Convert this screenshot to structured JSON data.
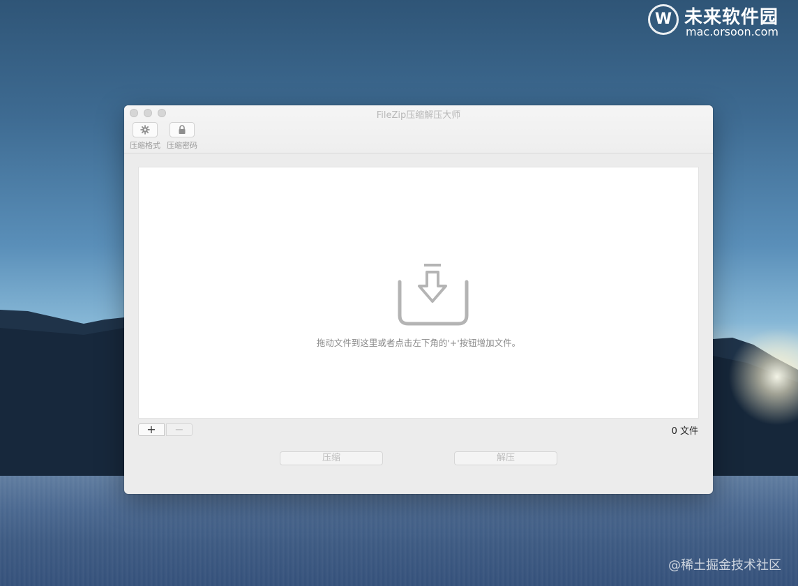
{
  "watermark": {
    "logo_mark": "W",
    "site_name": "未来软件园",
    "site_url": "mac.orsoon.com",
    "corner_text": "@稀土掘金技术社区"
  },
  "window": {
    "title": "FileZip压缩解压大师",
    "toolbar": [
      {
        "label": "压缩格式",
        "icon": "gear-icon"
      },
      {
        "label": "压缩密码",
        "icon": "lock-icon"
      }
    ]
  },
  "drop_area": {
    "icon": "download-tray-icon",
    "hint": "拖动文件到这里或者点击左下角的'+'按钮增加文件。"
  },
  "file_controls": {
    "add_label": "+",
    "remove_label": "−",
    "file_count": "0 文件"
  },
  "actions": {
    "compress_label": "压缩",
    "extract_label": "解压"
  },
  "colors": {
    "sky_top": "#2f5577",
    "window_bg": "#ececec",
    "icon_gray": "#b4b4b4"
  }
}
